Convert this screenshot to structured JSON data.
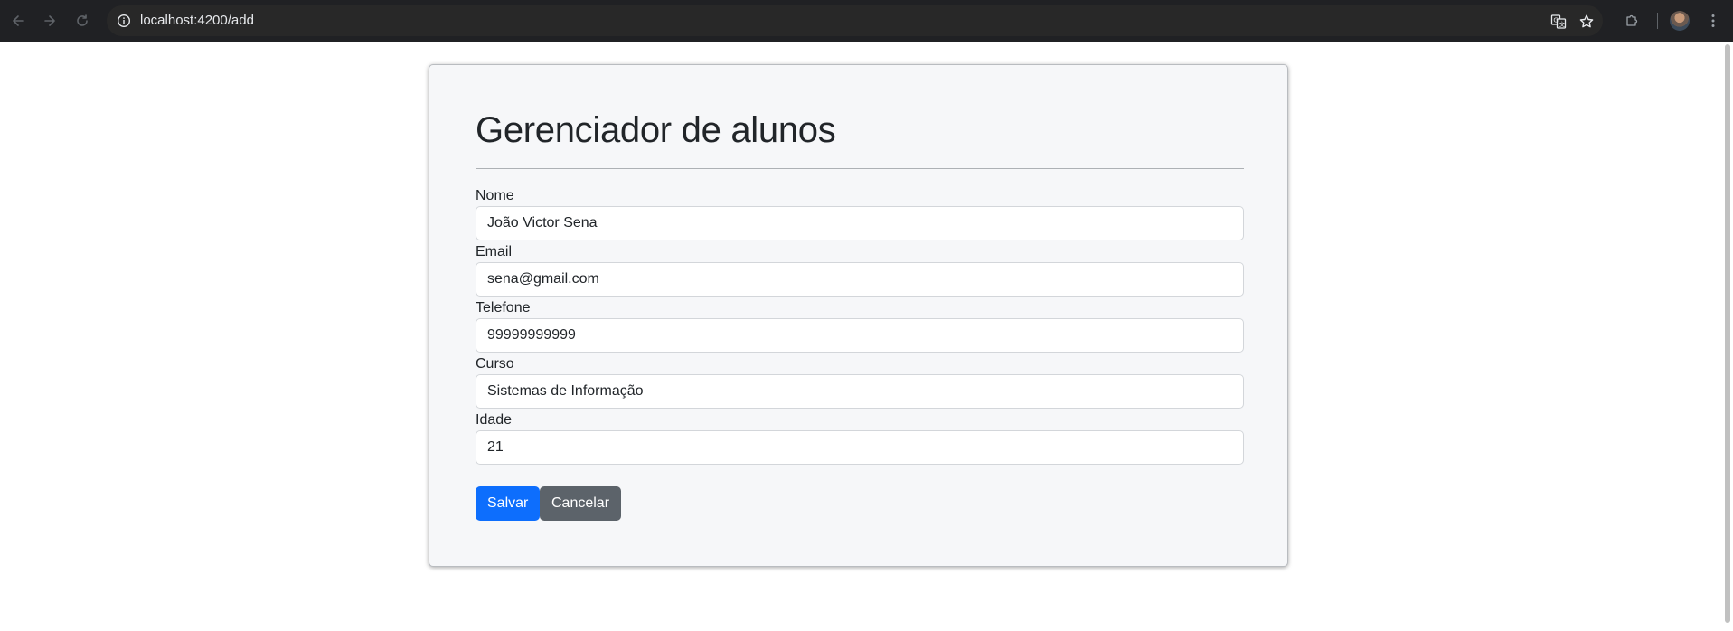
{
  "browser": {
    "url": "localhost:4200/add"
  },
  "form": {
    "title": "Gerenciador de alunos",
    "fields": [
      {
        "label": "Nome",
        "value": "João Victor Sena"
      },
      {
        "label": "Email",
        "value": "sena@gmail.com"
      },
      {
        "label": "Telefone",
        "value": "99999999999"
      },
      {
        "label": "Curso",
        "value": "Sistemas de Informação"
      },
      {
        "label": "Idade",
        "value": "21"
      }
    ],
    "save_label": "Salvar",
    "cancel_label": "Cancelar"
  },
  "colors": {
    "primary": "#0d6efd",
    "secondary": "#5c636a",
    "card_bg": "#f6f7f9",
    "chrome_bg": "#202124"
  },
  "icons": {
    "back": "arrow-left-icon",
    "forward": "arrow-right-icon",
    "reload": "reload-icon",
    "site_info": "info-icon",
    "translate": "translate-icon",
    "bookmark": "star-icon",
    "extensions": "puzzle-icon",
    "menu": "kebab-menu-icon"
  }
}
